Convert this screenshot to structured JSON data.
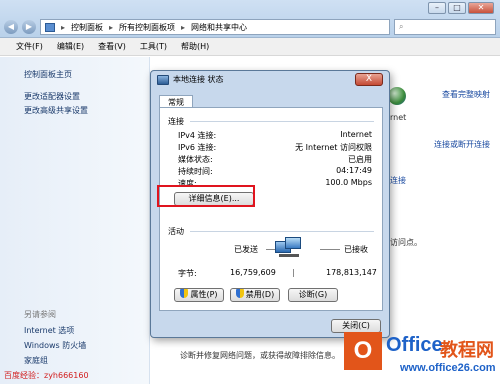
{
  "explorer": {
    "breadcrumb": [
      "控制面板",
      "所有控制面板项",
      "网络和共享中心"
    ],
    "menu": [
      "文件(F)",
      "编辑(E)",
      "查看(V)",
      "工具(T)",
      "帮助(H)"
    ],
    "left_links": [
      "控制面板主页",
      "更改适配器设置",
      "更改高级共享设置"
    ],
    "see_also_title": "另请参阅",
    "see_also": [
      "Internet 选项",
      "Windows 防火墙",
      "家庭组"
    ],
    "main": {
      "view_full_map": "查看完整映射",
      "internet": "rnet",
      "connect_or_disconnect": "连接或断开连接",
      "connection_link": "连接",
      "access_point": "访问点。",
      "diagnose_text": "诊断并修复网络问题，或获得故障排除信息。"
    }
  },
  "dialog": {
    "title": "本地连接 状态",
    "close": "X",
    "tab": "常规",
    "connection_section": "连接",
    "rows": [
      {
        "label": "IPv4 连接:",
        "value": "Internet"
      },
      {
        "label": "IPv6 连接:",
        "value": "无 Internet 访问权限"
      },
      {
        "label": "媒体状态:",
        "value": "已启用"
      },
      {
        "label": "持续时间:",
        "value": "04:17:49"
      },
      {
        "label": "速度:",
        "value": "100.0 Mbps"
      }
    ],
    "details_button": "详细信息(E)...",
    "activity_section": "活动",
    "sent_label": "已发送",
    "received_label": "已接收",
    "bytes_label": "字节:",
    "bytes_sent": "16,759,609",
    "bytes_received": "178,813,147",
    "properties_button": "属性(P)",
    "disable_button": "禁用(D)",
    "diagnose_button": "诊断(G)",
    "close_button": "关闭(C)"
  },
  "watermarks": {
    "baidu": "百度经验：zyh666160",
    "office_logo_letter": "O",
    "office_brand_1": "Office",
    "office_brand_2": "教程网",
    "office_site": "www.office26.com"
  }
}
